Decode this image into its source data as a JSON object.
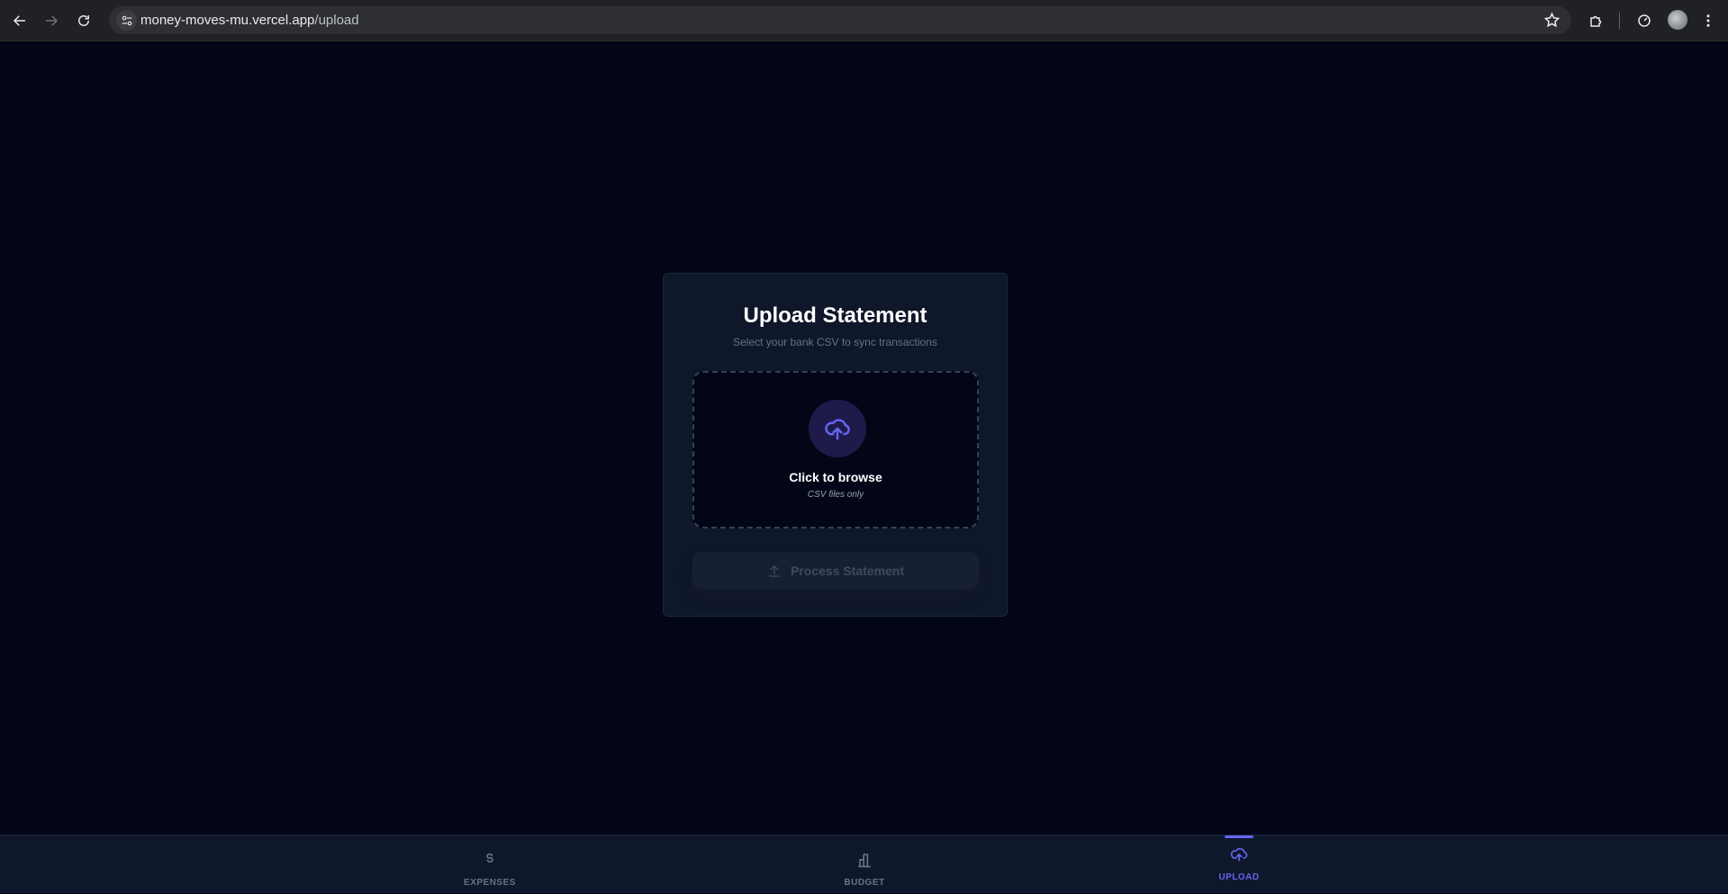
{
  "browser": {
    "url_host": "money-moves-mu.vercel.app",
    "url_path": "/upload"
  },
  "card": {
    "title": "Upload Statement",
    "subtitle": "Select your bank CSV to sync transactions"
  },
  "dropzone": {
    "label": "Click to browse",
    "hint": "CSV files only"
  },
  "process_button": {
    "label": "Process Statement",
    "disabled": true
  },
  "bottom_nav": {
    "items": [
      {
        "label": "EXPENSES",
        "icon": "dollar-icon",
        "active": false
      },
      {
        "label": "BUDGET",
        "icon": "bar-chart-icon",
        "active": false
      },
      {
        "label": "UPLOAD",
        "icon": "cloud-upload-icon",
        "active": true
      }
    ]
  },
  "colors": {
    "background": "#020617",
    "card": "#0f172a",
    "accent": "#6366f1"
  }
}
